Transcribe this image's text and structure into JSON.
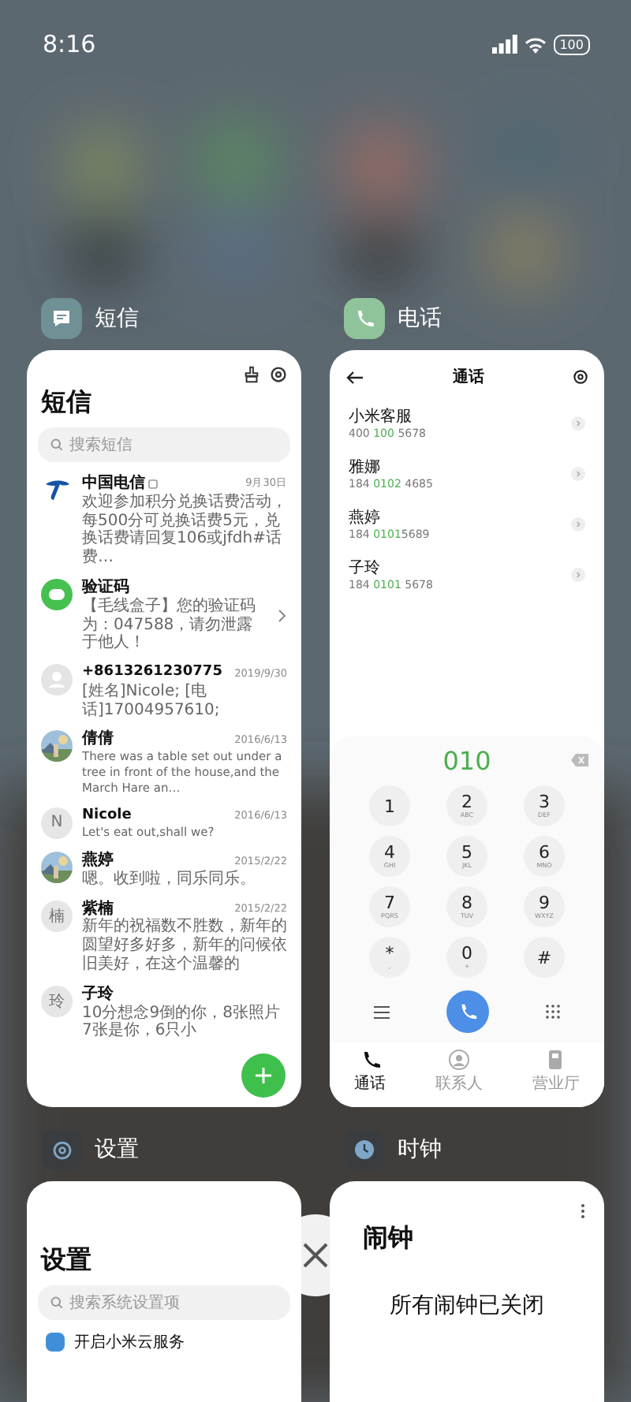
{
  "status_bar": {
    "time": "8:16",
    "battery": "100"
  },
  "messages_app": {
    "label": "短信",
    "title": "短信",
    "search_placeholder": "搜索短信",
    "threads": [
      {
        "kind": "telecom",
        "name": "中国电信",
        "badge": true,
        "chevron": false,
        "date": "9月30日",
        "preview": "欢迎参加积分兑换话费活动，每500分可兑换话费5元，兑换话费请回复106或jfdh#话费…"
      },
      {
        "kind": "chat",
        "name": "验证码",
        "badge": false,
        "chevron": true,
        "preview": "【毛线盒子】您的验证码为：047588，请勿泄露于他人！"
      },
      {
        "kind": "person",
        "name": "+8613261230775",
        "badge": false,
        "chevron": false,
        "date": "2019/9/30",
        "preview": "[姓名]Nicole; [电话]17004957610;"
      },
      {
        "name": "倩倩",
        "badge": false,
        "chevron": false,
        "date": "2016/6/13",
        "preview": "There was a table set out under a tree in front of the house,and the March Hare an…"
      },
      {
        "kind": "letter",
        "initial": "N",
        "name": "Nicole",
        "badge": false,
        "chevron": false,
        "date": "2016/6/13",
        "preview": "Let's eat out,shall we?"
      },
      {
        "name": "燕婷",
        "badge": false,
        "chevron": false,
        "date": "2015/2/22",
        "preview": "嗯。收到啦，同乐同乐。"
      },
      {
        "kind": "letter",
        "initial": "楠",
        "name": "紫楠",
        "badge": false,
        "chevron": false,
        "date": "2015/2/22",
        "preview": "新年的祝福数不胜数，新年的圆望好多好多，新年的问候依旧美好，在这个温馨的"
      },
      {
        "kind": "letter",
        "initial": "玲",
        "name": "子玲",
        "badge": false,
        "chevron": false,
        "preview": "10分想念9倒的你，8张照片7张是你，6只小"
      }
    ]
  },
  "phone_app": {
    "label": "电话",
    "title": "通话",
    "contacts": [
      {
        "name": "小米客服",
        "number": {
          "before": "400 ",
          "match": "100",
          "after": " 5678"
        }
      },
      {
        "name": "雅娜",
        "number": {
          "before": "184 ",
          "match": "0102",
          "after": " 4685"
        }
      },
      {
        "name": "燕婷",
        "number": {
          "before": "184 ",
          "match": "0101",
          "after": "5689"
        }
      },
      {
        "name": "子玲",
        "number": {
          "before": "184 ",
          "match": "0101",
          "after": " 5678"
        }
      }
    ],
    "dialed": "010",
    "keys": [
      {
        "digit": "1"
      },
      {
        "digit": "2",
        "letters": "ABC"
      },
      {
        "digit": "3",
        "letters": "DEF"
      },
      {
        "digit": "4",
        "letters": "GHI"
      },
      {
        "digit": "5",
        "letters": "JKL"
      },
      {
        "digit": "6",
        "letters": "MNO"
      },
      {
        "digit": "7",
        "letters": "PQRS"
      },
      {
        "digit": "8",
        "letters": "TUV"
      },
      {
        "digit": "9",
        "letters": "WXYZ"
      },
      {
        "digit": "*",
        "letters": ","
      },
      {
        "digit": "0",
        "letters": "+"
      },
      {
        "digit": "#"
      }
    ],
    "tabs": [
      {
        "kind": "calls",
        "label": "通话",
        "selected": true
      },
      {
        "kind": "contacts",
        "label": "联系人",
        "selected": false
      },
      {
        "kind": "store",
        "label": "营业厅",
        "selected": false
      }
    ]
  },
  "settings_app": {
    "label": "设置",
    "title": "设置",
    "search_placeholder": "搜索系统设置项",
    "first_item": "开启小米云服务"
  },
  "clock_app": {
    "label": "时钟",
    "title": "闹钟",
    "message": "所有闹钟已关闭"
  }
}
